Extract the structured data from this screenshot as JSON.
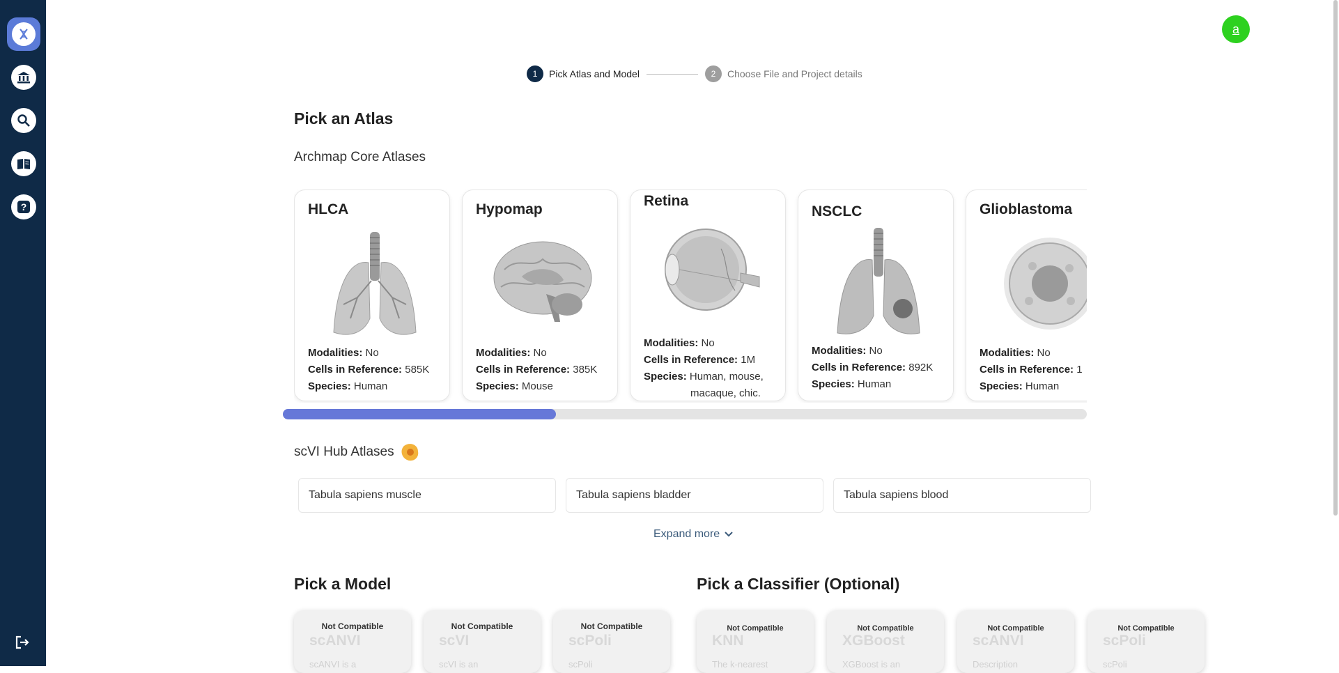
{
  "user": {
    "avatar_letter": "a"
  },
  "sidebar": {
    "items": [
      {
        "icon": "dna-icon",
        "active": true
      },
      {
        "icon": "bank-icon",
        "active": false
      },
      {
        "icon": "search-icon",
        "active": false
      },
      {
        "icon": "book-icon",
        "active": false
      },
      {
        "icon": "help-icon",
        "active": false
      }
    ],
    "logout_icon": "logout-icon"
  },
  "stepper": {
    "steps": [
      {
        "number": "1",
        "label": "Pick Atlas and Model",
        "active": true
      },
      {
        "number": "2",
        "label": "Choose File and Project details",
        "active": false
      }
    ]
  },
  "atlas_section": {
    "title": "Pick an Atlas",
    "core_subtitle": "Archmap Core Atlases",
    "cards": [
      {
        "name": "HLCA",
        "image": "lungs-illustration",
        "modalities_label": "Modalities:",
        "modalities": "No",
        "cells_label": "Cells in Reference:",
        "cells": "585K",
        "species_label": "Species:",
        "species": "Human"
      },
      {
        "name": "Hypomap",
        "image": "brain-illustration",
        "modalities_label": "Modalities:",
        "modalities": "No",
        "cells_label": "Cells in Reference:",
        "cells": "385K",
        "species_label": "Species:",
        "species": "Mouse"
      },
      {
        "name": "Retina",
        "image": "eye-illustration",
        "modalities_label": "Modalities:",
        "modalities": "No",
        "cells_label": "Cells in Reference:",
        "cells": "1M",
        "species_label": "Species:",
        "species": "Human, mouse,",
        "species_line2": "macaque, chic."
      },
      {
        "name": "NSCLC",
        "image": "lungs-tumor-illustration",
        "modalities_label": "Modalities:",
        "modalities": "No",
        "cells_label": "Cells in Reference:",
        "cells": "892K",
        "species_label": "Species:",
        "species": "Human"
      },
      {
        "name": "Glioblastoma",
        "image": "tumor-cell-illustration",
        "modalities_label": "Modalities:",
        "modalities": "No",
        "cells_label": "Cells in Reference:",
        "cells": "1",
        "species_label": "Species:",
        "species": "Human"
      }
    ],
    "scroll_fraction": 0.34,
    "hub_subtitle": "scVI Hub Atlases",
    "hub_icon": "scvi-hub-icon",
    "hub_items": [
      "Tabula sapiens muscle",
      "Tabula sapiens bladder",
      "Tabula sapiens blood"
    ],
    "expand_label": "Expand more"
  },
  "model_section": {
    "title": "Pick a Model",
    "models": [
      {
        "status": "Not Compatible",
        "name": "scANVI",
        "desc": "scANVI is a"
      },
      {
        "status": "Not Compatible",
        "name": "scVI",
        "desc": "scVI is an"
      },
      {
        "status": "Not Compatible",
        "name": "scPoli",
        "desc": "scPoli"
      }
    ]
  },
  "classifier_section": {
    "title": "Pick a Classifier (Optional)",
    "classifiers": [
      {
        "status": "Not Compatible",
        "name": "KNN",
        "desc": "The k-nearest"
      },
      {
        "status": "Not Compatible",
        "name": "XGBoost",
        "desc": "XGBoost is an"
      },
      {
        "status": "Not Compatible",
        "name": "scANVI",
        "desc": "Description"
      },
      {
        "status": "Not Compatible",
        "name": "scPoli",
        "desc": "scPoli"
      }
    ]
  }
}
